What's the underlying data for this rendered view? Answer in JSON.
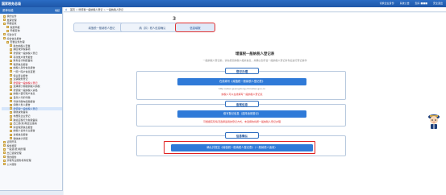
{
  "topbar": {
    "logo": "国家税务总局",
    "links": [
      "切换企业身份",
      "系统公告",
      "您好 ■■■",
      "安全退出"
    ]
  },
  "sidebar": {
    "header": "菜单功能",
    "collapse": "收起",
    "items": [
      {
        "label": "我的业务",
        "level": 1
      },
      {
        "label": "发票管理",
        "level": 1
      },
      {
        "label": "申报征收",
        "level": 1
      },
      {
        "label": "税费申报",
        "level": 2
      },
      {
        "label": "申报查询",
        "level": 2
      },
      {
        "label": "行政许可",
        "level": 1
      },
      {
        "label": "综合信息报告",
        "level": 1
      },
      {
        "label": "套餐业务办理",
        "level": 2
      },
      {
        "label": "新办纳税人套餐",
        "level": 3
      },
      {
        "label": "跨区域涉税事项",
        "level": 3
      },
      {
        "label": "增值税一般纳税人登记",
        "level": 3
      },
      {
        "label": "存款账户账号报告",
        "level": 3
      },
      {
        "label": "财务会计制度备案",
        "level": 3
      },
      {
        "label": "税源信息报告",
        "level": 3
      },
      {
        "label": "纳税人身份信息报告",
        "level": 3
      },
      {
        "label": "一照一码户信息变更",
        "level": 3
      },
      {
        "label": "停业复业报告",
        "level": 3
      },
      {
        "label": "注销税务登记",
        "level": 3
      },
      {
        "label": "增值税一般纳税人登记",
        "level": 3,
        "hl": true
      },
      {
        "label": "选择按小规模纳税人纳税",
        "level": 3
      },
      {
        "label": "增值税一般纳税人资格",
        "level": 3
      },
      {
        "label": "纳税人银行账户信息",
        "level": 3
      },
      {
        "label": "自然人代扣代缴",
        "level": 3
      },
      {
        "label": "代收代缴车船税报告",
        "level": 3
      },
      {
        "label": "扣缴义务人报告",
        "level": 3
      },
      {
        "label": "增值税一般纳税人登记",
        "level": 3,
        "sel": true
      },
      {
        "label": "税收减免备案",
        "level": 3
      },
      {
        "label": "非居民企业登记",
        "level": 3
      },
      {
        "label": "跨境应税行为免税备案",
        "level": 3
      },
      {
        "label": "出口退(免)税企业备案",
        "level": 3
      },
      {
        "label": "综合税源信息报告",
        "level": 3
      },
      {
        "label": "纳税人合并分立报告",
        "level": 3
      },
      {
        "label": "资格信息报告",
        "level": 3
      },
      {
        "label": "税收统计调查",
        "level": 3
      },
      {
        "label": "证明开具",
        "level": 1
      },
      {
        "label": "税务稽查",
        "level": 1
      },
      {
        "label": "一般退(抵)税管理",
        "level": 1
      },
      {
        "label": "出口退税管理",
        "level": 1
      },
      {
        "label": "预约服务",
        "level": 1
      },
      {
        "label": "涉税专业服务机构管理",
        "level": 1
      },
      {
        "label": "公众服务",
        "level": 1
      }
    ]
  },
  "breadcrumb": "首页  >  增值税一般纳税人登记  >  一般纳税人登记",
  "steps": [
    {
      "label": "增值税一般纳税人登记",
      "active": false
    },
    {
      "label": "纳（扣）税人信息确认",
      "active": false
    },
    {
      "label": "信息填报",
      "active": true
    }
  ],
  "step_number": "3",
  "main_title": "增值税一般纳税人登记表",
  "sub_text": "一般纳税人登记前，请先核实纳税人相关信息，并确认您符合一般纳税人登记条件后进行登记操作",
  "sections": [
    {
      "title": "登记办理",
      "button": "在线填写《增值税一般纳税人登记表》",
      "hint_gray": "http://etax.guangdong.chinatax.gov.cn",
      "hint_red": "纳税人可以在线填写一般纳税人登记表"
    },
    {
      "title": "备案信息",
      "button": "填写登记信息（选择适用登记）",
      "hint_gray": "",
      "hint_red": "可根据实际情况选择适用的登记方式，未选择的将按一般纳税人登记办理"
    },
    {
      "title": "信息确认",
      "button": "确认并提交《增值税一般纳税人登记表》（一般纳税人适用）",
      "hint_gray": "",
      "hint_red": ""
    }
  ]
}
